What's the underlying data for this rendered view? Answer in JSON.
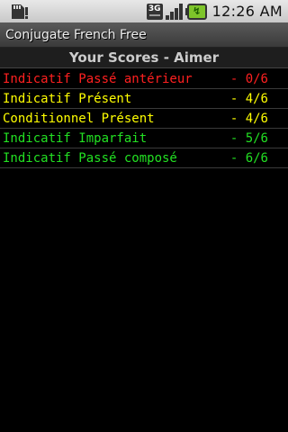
{
  "status_bar": {
    "left_icon": "sd-card-icon",
    "network_label": "3G",
    "signal_icon": "signal-icon",
    "battery_icon": "battery-charging-icon",
    "time": "12:26 AM"
  },
  "app": {
    "title": "Conjugate French Free"
  },
  "header": {
    "title": "Your Scores - Aimer"
  },
  "colors": {
    "red": "#ff2020",
    "yellow": "#ffff00",
    "green": "#22e022"
  },
  "scores": [
    {
      "tense": "Indicatif Passé antérieur",
      "score": "- 0/6",
      "color": "red"
    },
    {
      "tense": "Indicatif Présent",
      "score": "- 4/6",
      "color": "yellow"
    },
    {
      "tense": "Conditionnel Présent",
      "score": "- 4/6",
      "color": "yellow"
    },
    {
      "tense": "Indicatif Imparfait",
      "score": "- 5/6",
      "color": "green"
    },
    {
      "tense": "Indicatif Passé composé",
      "score": "- 6/6",
      "color": "green"
    }
  ]
}
